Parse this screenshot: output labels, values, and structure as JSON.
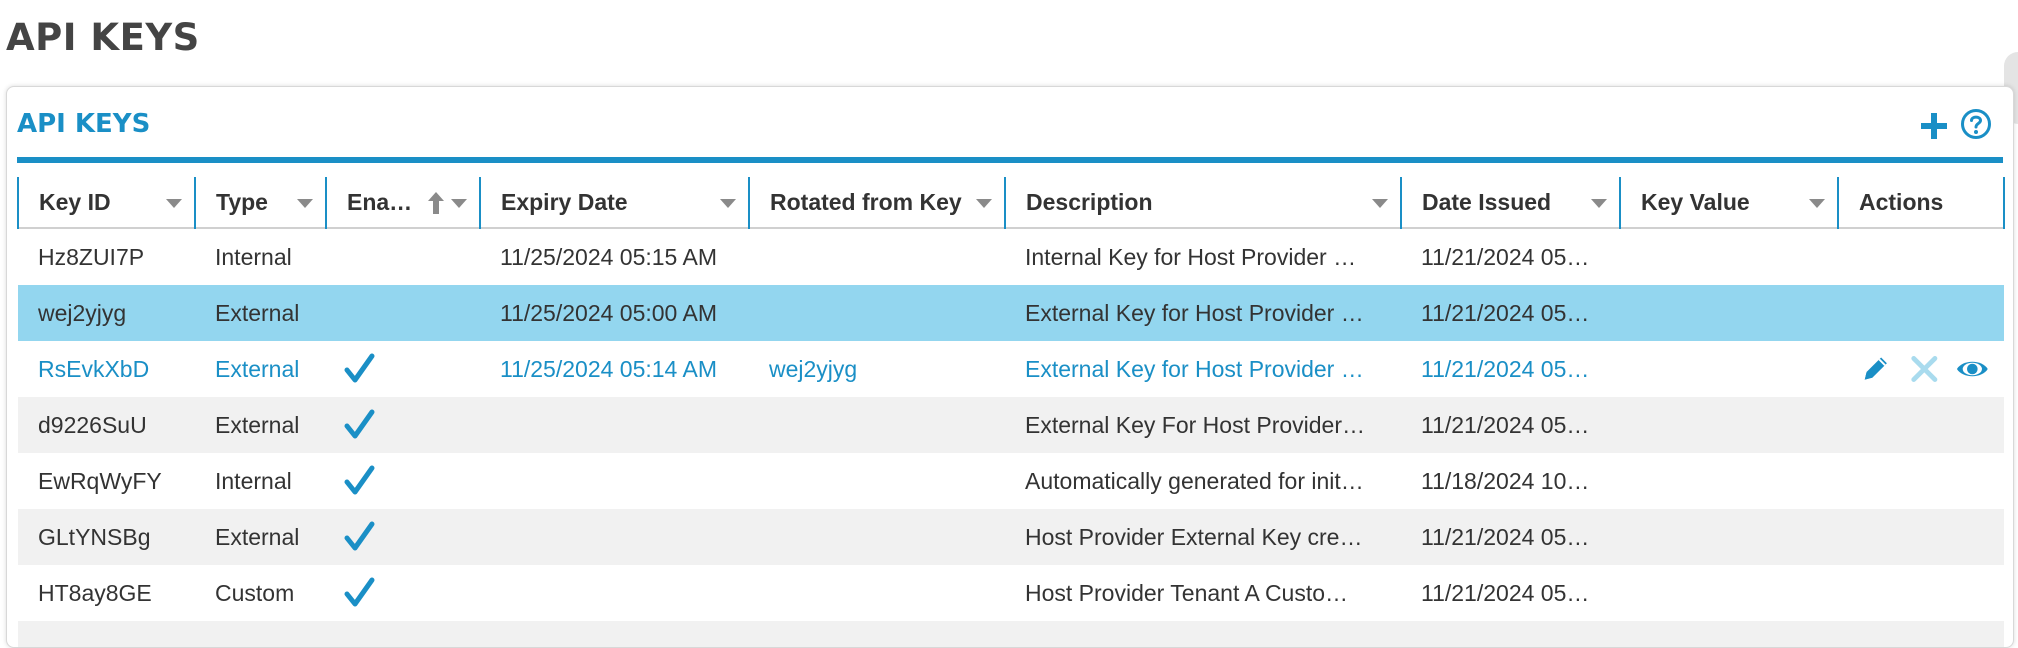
{
  "page": {
    "title": "API KEYS"
  },
  "panel": {
    "title": "API KEYS"
  },
  "columns": [
    {
      "label": "Key ID"
    },
    {
      "label": "Type"
    },
    {
      "label": "Ena…"
    },
    {
      "label": "Expiry Date"
    },
    {
      "label": "Rotated from Key"
    },
    {
      "label": "Description"
    },
    {
      "label": "Date Issued"
    },
    {
      "label": "Key Value"
    },
    {
      "label": "Actions"
    }
  ],
  "rows": [
    {
      "key_id": "Hz8ZUI7P",
      "type": "Internal",
      "enabled": false,
      "expiry": "11/25/2024 05:15 AM",
      "rotated_from": "",
      "description": "Internal Key for Host Provider …",
      "issued": "11/21/2024 05…",
      "key_value": ""
    },
    {
      "key_id": "wej2yjyg",
      "type": "External",
      "enabled": false,
      "expiry": "11/25/2024 05:00 AM",
      "rotated_from": "",
      "description": "External Key for Host Provider …",
      "issued": "11/21/2024 05…",
      "key_value": ""
    },
    {
      "key_id": "RsEvkXbD",
      "type": "External",
      "enabled": true,
      "expiry": "11/25/2024 05:14 AM",
      "rotated_from": "wej2yjyg",
      "description": "External Key for Host Provider …",
      "issued": "11/21/2024 05…",
      "key_value": ""
    },
    {
      "key_id": "d9226SuU",
      "type": "External",
      "enabled": true,
      "expiry": "",
      "rotated_from": "",
      "description": "External Key For Host Provider…",
      "issued": "11/21/2024 05…",
      "key_value": ""
    },
    {
      "key_id": "EwRqWyFY",
      "type": "Internal",
      "enabled": true,
      "expiry": "",
      "rotated_from": "",
      "description": "Automatically generated for init…",
      "issued": "11/18/2024 10…",
      "key_value": ""
    },
    {
      "key_id": "GLtYNSBg",
      "type": "External",
      "enabled": true,
      "expiry": "",
      "rotated_from": "",
      "description": "Host Provider External Key cre…",
      "issued": "11/21/2024 05…",
      "key_value": ""
    },
    {
      "key_id": "HT8ay8GE",
      "type": "Custom",
      "enabled": true,
      "expiry": "",
      "rotated_from": "",
      "description": "Host Provider Tenant A Custo…",
      "issued": "11/21/2024 05…",
      "key_value": ""
    }
  ],
  "state": {
    "selected_row": 1,
    "hover_row": 2,
    "sorted_column": "Ena…",
    "sort_direction": "ascending"
  },
  "row_actions": [
    "edit-icon",
    "delete-icon",
    "view-icon"
  ],
  "colors": {
    "accent": "#1a8fc6",
    "selected_row": "#93d6ef",
    "alt_row": "#f1f1f1",
    "delete_disabled": "#a9dbee"
  }
}
